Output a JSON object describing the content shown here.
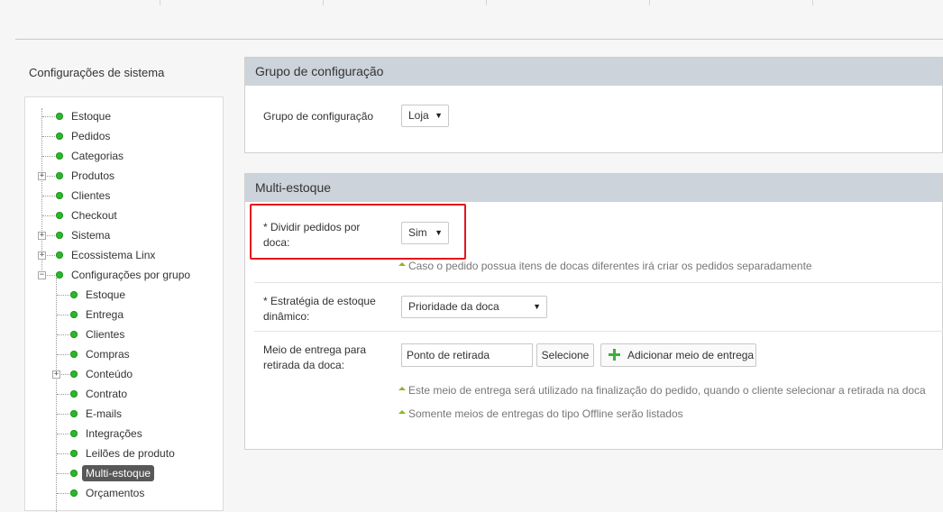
{
  "sidebar": {
    "title": "Configurações de sistema",
    "items": [
      {
        "label": "Estoque",
        "expandable": false
      },
      {
        "label": "Pedidos",
        "expandable": false
      },
      {
        "label": "Categorias",
        "expandable": false
      },
      {
        "label": "Produtos",
        "expandable": true
      },
      {
        "label": "Clientes",
        "expandable": false
      },
      {
        "label": "Checkout",
        "expandable": false
      },
      {
        "label": "Sistema",
        "expandable": true
      },
      {
        "label": "Ecossistema Linx",
        "expandable": true
      },
      {
        "label": "Configurações por grupo",
        "expandable": true,
        "expanded": true
      }
    ],
    "group_items": [
      {
        "label": "Estoque"
      },
      {
        "label": "Entrega"
      },
      {
        "label": "Clientes"
      },
      {
        "label": "Compras"
      },
      {
        "label": "Conteúdo",
        "expandable": true
      },
      {
        "label": "Contrato"
      },
      {
        "label": "E-mails"
      },
      {
        "label": "Integrações"
      },
      {
        "label": "Leilões de produto"
      },
      {
        "label": "Multi-estoque",
        "active": true
      },
      {
        "label": "Orçamentos"
      }
    ],
    "status_color": "#2fb42f",
    "active_bg": "#585858"
  },
  "panel_group": {
    "header": "Grupo de configuração",
    "label": "Grupo de configuração",
    "select_value": "Loja"
  },
  "panel_multi": {
    "header": "Multi-estoque",
    "split_label": "* Dividir pedidos por doca:",
    "split_value": "Sim",
    "split_hint": "Caso o pedido possua itens de docas diferentes irá criar os pedidos separadamente",
    "strategy_label": "* Estratégia de estoque dinâmico:",
    "strategy_value": "Prioridade da doca",
    "delivery_label": "Meio de entrega para retirada da doca:",
    "delivery_value": "Ponto de retirada",
    "select_button": "Selecione",
    "add_button": "Adicionar meio de entrega",
    "delivery_hint_1": "Este meio de entrega será utilizado na finalização do pedido, quando o cliente selecionar a retirada na doca",
    "delivery_hint_2": "Somente meios de entregas do tipo Offline serão listados"
  },
  "colors": {
    "header_bg": "#ccd3da",
    "highlight": "#e3161b",
    "hint_arrow": "#8db52a",
    "add_icon": "#3fae3f"
  }
}
